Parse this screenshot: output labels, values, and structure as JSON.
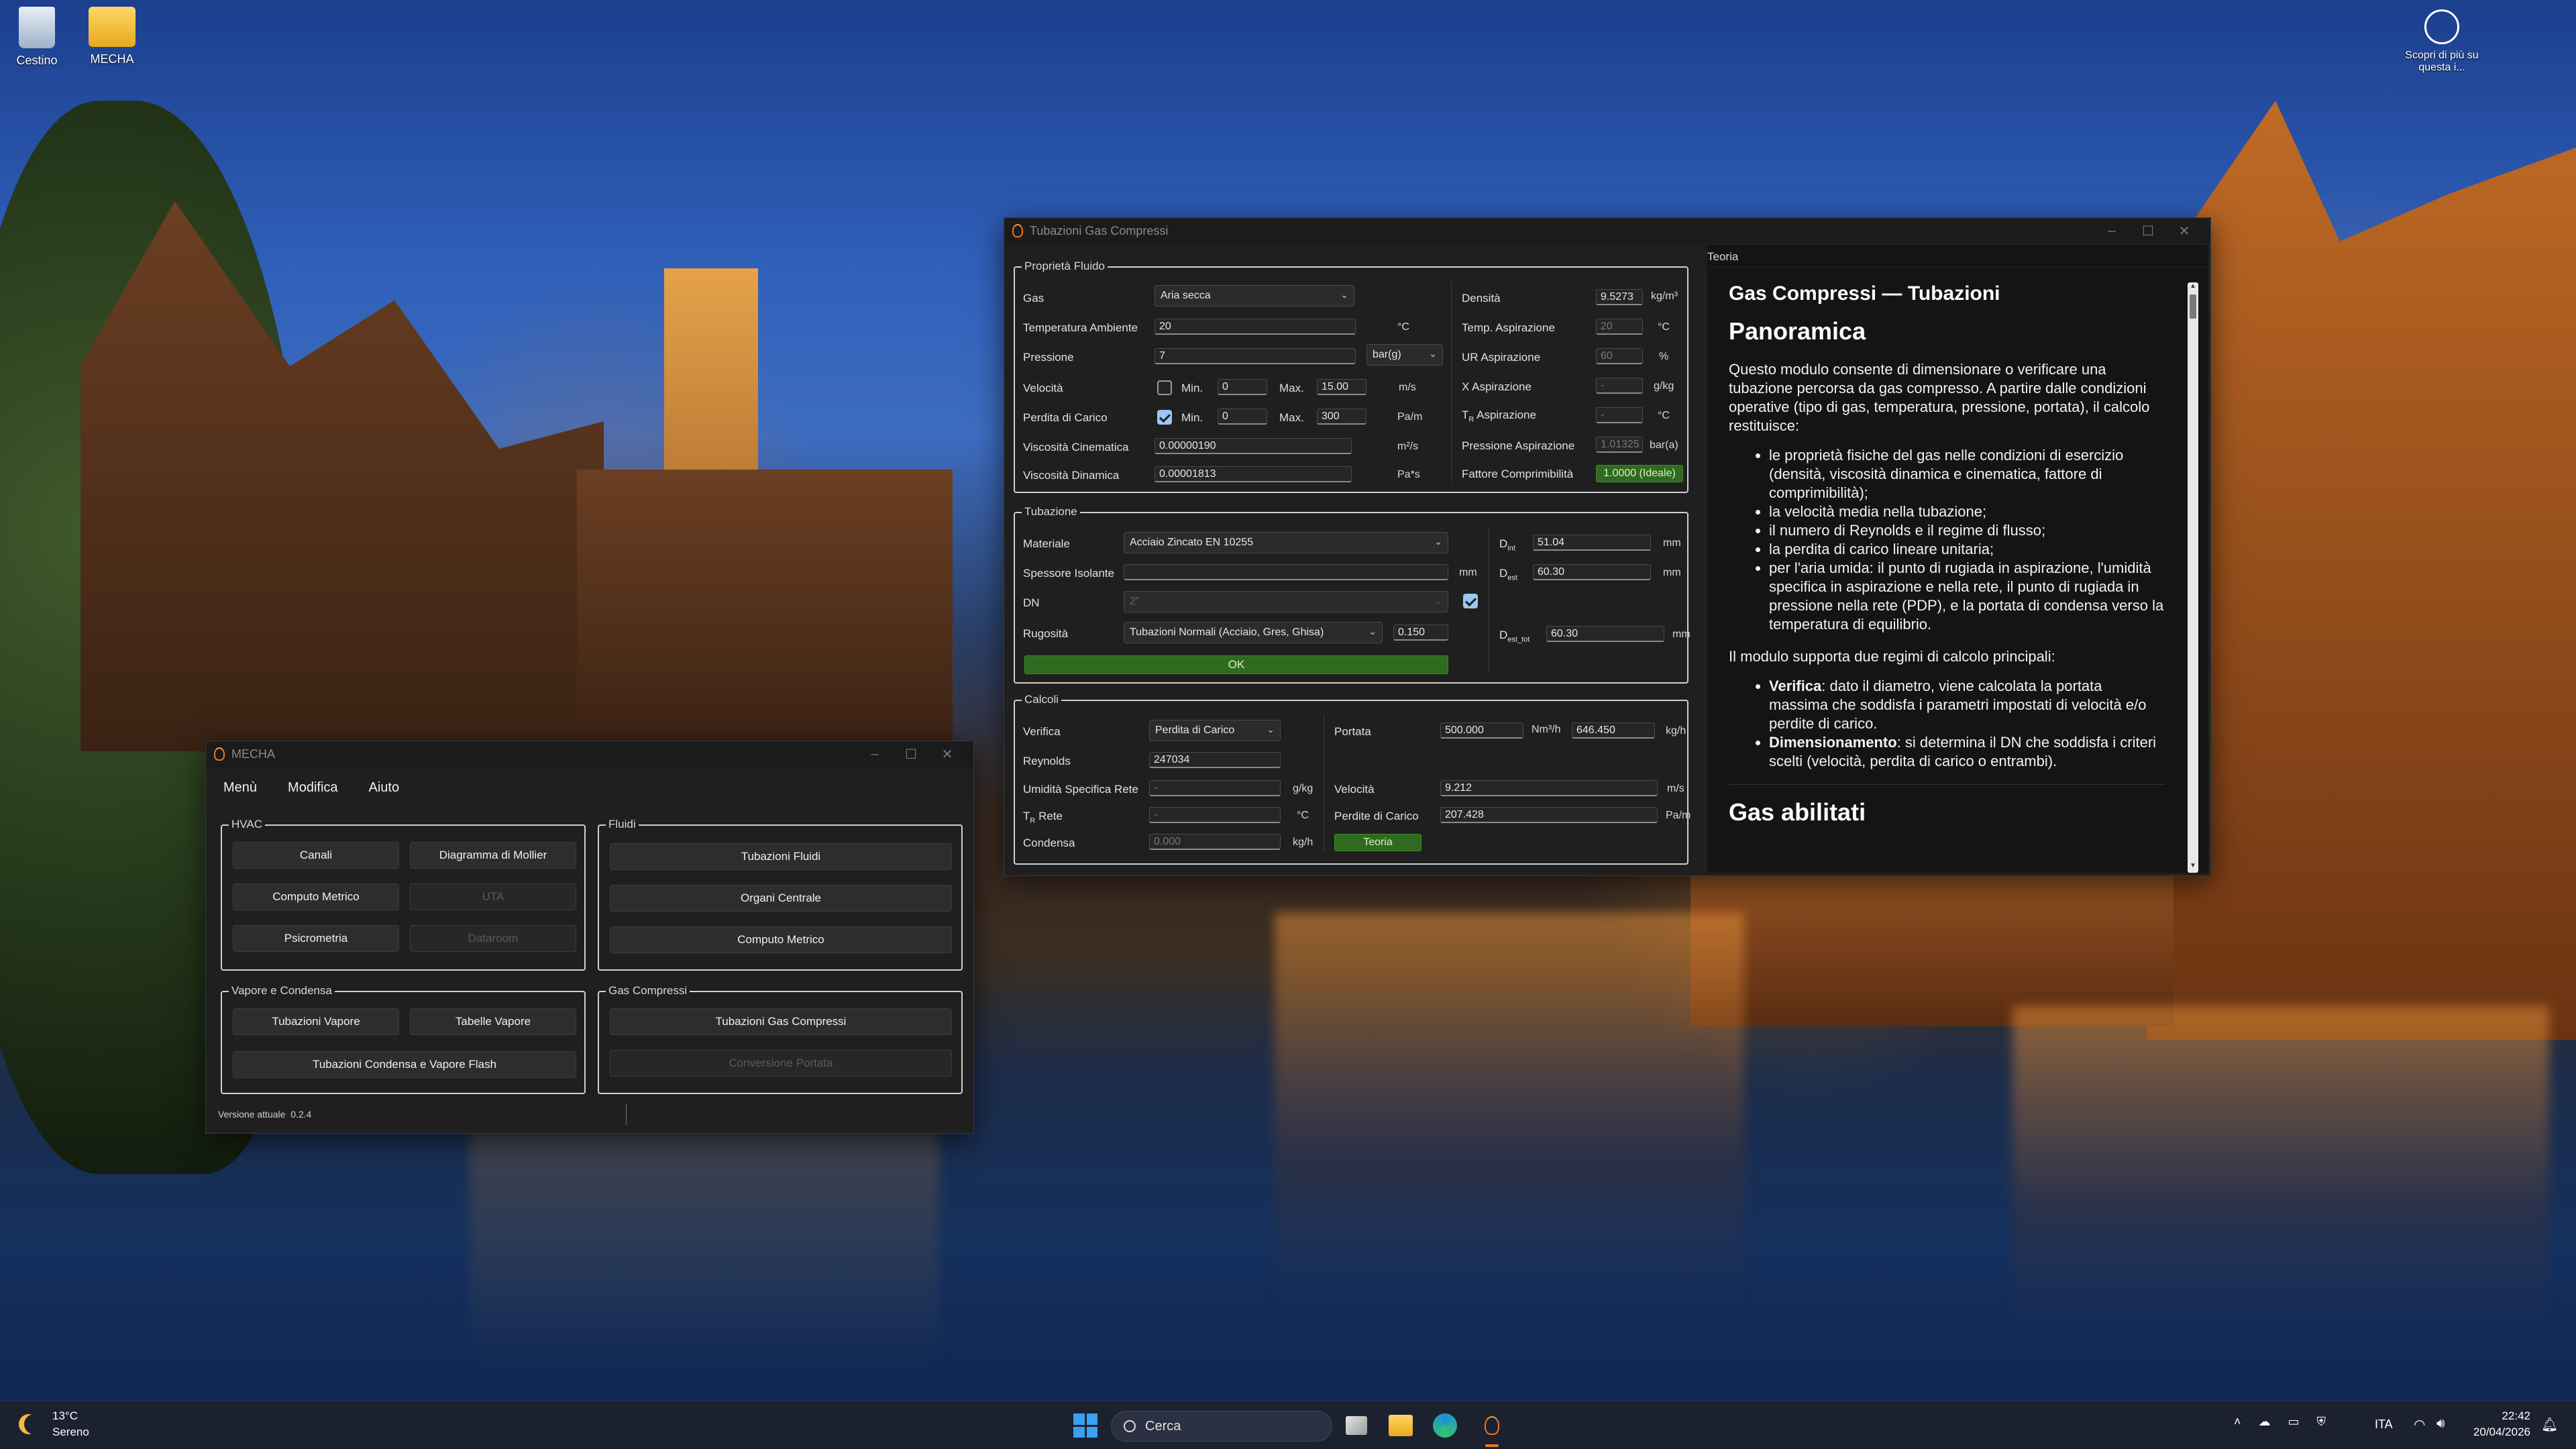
{
  "desktop": {
    "recycle_bin": "Cestino",
    "folder": "MECHA",
    "spotlight": "Scopri di più su questa i..."
  },
  "mecha": {
    "title": "MECHA",
    "menu": [
      "Menù",
      "Modifica",
      "Aiuto"
    ],
    "hvac": {
      "label": "HVAC",
      "buttons": [
        "Canali",
        "Diagramma di Mollier",
        "Computo Metrico",
        "UTA",
        "Psicrometria",
        "Dataroom"
      ]
    },
    "fluidi": {
      "label": "Fluidi",
      "buttons": [
        "Tubazioni Fluidi",
        "Organi Centrale",
        "Computo Metrico"
      ]
    },
    "vapore": {
      "label": "Vapore e Condensa",
      "buttons": [
        "Tubazioni Vapore",
        "Tabelle Vapore",
        "Tubazioni Condensa e Vapore Flash"
      ]
    },
    "gas": {
      "label": "Gas Compressi",
      "buttons": [
        "Tubazioni Gas Compressi",
        "Conversione Portata"
      ]
    },
    "version_label": "Versione attuale",
    "version": "0.2.4"
  },
  "tgc": {
    "title": "Tubazioni Gas Compressi",
    "fluid": {
      "label": "Proprietà Fluido",
      "gas_label": "Gas",
      "gas": "Aria secca",
      "tamb_label": "Temperatura Ambiente",
      "tamb": "20",
      "tamb_unit": "°C",
      "press_label": "Pressione",
      "press": "7",
      "press_unit": "bar(g)",
      "vel_label": "Velocità",
      "min_label": "Min.",
      "max_label": "Max.",
      "vel_min": "0",
      "vel_max": "15.00",
      "vel_unit": "m/s",
      "dp_label": "Perdita di Carico",
      "dp_min": "0",
      "dp_max": "300",
      "dp_unit": "Pa/m",
      "visc_cin_label": "Viscosità Cinematica",
      "visc_cin": "0.00000190",
      "visc_cin_unit": "m²/s",
      "visc_din_label": "Viscosità Dinamica",
      "visc_din": "0.00001813",
      "visc_din_unit": "Pa*s",
      "dens_label": "Densità",
      "dens": "9.5273",
      "dens_unit": "kg/m³",
      "tasp_label": "Temp. Aspirazione",
      "tasp": "20",
      "tasp_unit": "°C",
      "urasp_label": "UR Aspirazione",
      "urasp": "60",
      "urasp_unit": "%",
      "xasp_label": "X Aspirazione",
      "xasp": "-",
      "xasp_unit": "g/kg",
      "tr_label": "T",
      "tr_sub": "R",
      "tr_label2": " Aspirazione",
      "tr": "-",
      "tr_unit": "°C",
      "pasp_label": "Pressione Aspirazione",
      "pasp": "1.01325",
      "pasp_unit": "bar(a)",
      "fz_label": "Fattore Comprimibilità",
      "fz": "1.0000 (Ideale)"
    },
    "pipe": {
      "label": "Tubazione",
      "mat_label": "Materiale",
      "mat": "Acciaio Zincato EN 10255",
      "ins_label": "Spessore Isolante",
      "ins_unit": "mm",
      "dn_label": "DN",
      "dn": "2\"",
      "rug_label": "Rugosità",
      "rug": "Tubazioni Normali (Acciaio, Gres, Ghisa)",
      "rug_val": "0.150",
      "ok": "OK",
      "dint_label": "D",
      "dint_sub": "int",
      "dint": "51.04",
      "dint_unit": "mm",
      "dest_label": "D",
      "dest_sub": "est",
      "dest": "60.30",
      "dest_unit": "mm",
      "desttot_label": "D",
      "desttot_sub": "est_tot",
      "desttot": "60.30",
      "desttot_unit": "mm"
    },
    "calc": {
      "label": "Calcoli",
      "ver_label": "Verifica",
      "ver": "Perdita di Carico",
      "re_label": "Reynolds",
      "re": "247034",
      "ums_label": "Umidità Specifica Rete",
      "ums": "-",
      "ums_unit": "g/kg",
      "trr_label": "T",
      "trr_sub": "R",
      "trr_label2": " Rete",
      "trr": "-",
      "trr_unit": "°C",
      "cond_label": "Condensa",
      "cond": "0.000",
      "cond_unit": "kg/h",
      "port_label": "Portata",
      "port_nm": "500.000",
      "port_nm_unit": "Nm³/h",
      "port_kg": "646.450",
      "port_kg_unit": "kg/h",
      "vel_label": "Velocità",
      "vel": "9.212",
      "vel_unit": "m/s",
      "dp_label": "Perdite di Carico",
      "dp": "207.428",
      "dp_unit": "Pa/m",
      "teoria": "Teoria"
    }
  },
  "theory": {
    "tab": "Teoria",
    "title": "Gas Compressi — Tubazioni",
    "h_panoramica": "Panoramica",
    "p1": "Questo modulo consente di dimensionare o verificare una tubazione percorsa da gas compresso. A partire dalle condizioni operative (tipo di gas, temperatura, pressione, portata), il calcolo restituisce:",
    "list1": [
      "le proprietà fisiche del gas nelle condizioni di esercizio (densità, viscosità dinamica e cinematica, fattore di comprimibilità);",
      "la velocità media nella tubazione;",
      "il numero di Reynolds e il regime di flusso;",
      "la perdita di carico lineare unitaria;",
      "per l'aria umida: il punto di rugiada in aspirazione, l'umidità specifica in aspirazione e nella rete, il punto di rugiada in pressione nella rete (PDP), e la portata di condensa verso la temperatura di equilibrio."
    ],
    "p2": "Il modulo supporta due regimi di calcolo principali:",
    "verifica_b": "Verifica",
    "verifica_t": ": dato il diametro, viene calcolata la portata massima che soddisfa i parametri impostati di velocità e/o perdite di carico.",
    "dim_b": "Dimensionamento",
    "dim_t": ": si determina il DN che soddisfa i criteri scelti (velocità, perdita di carico o entrambi).",
    "h_gas": "Gas abilitati"
  },
  "taskbar": {
    "temp": "13°C",
    "weather": "Sereno",
    "search": "Cerca",
    "lang": "ITA",
    "time": "22:42",
    "date": "20/04/2026"
  },
  "colors": {
    "accent_green": "#2f6b1f",
    "window_bg": "#1f1f1f",
    "flame": "#e87722"
  }
}
